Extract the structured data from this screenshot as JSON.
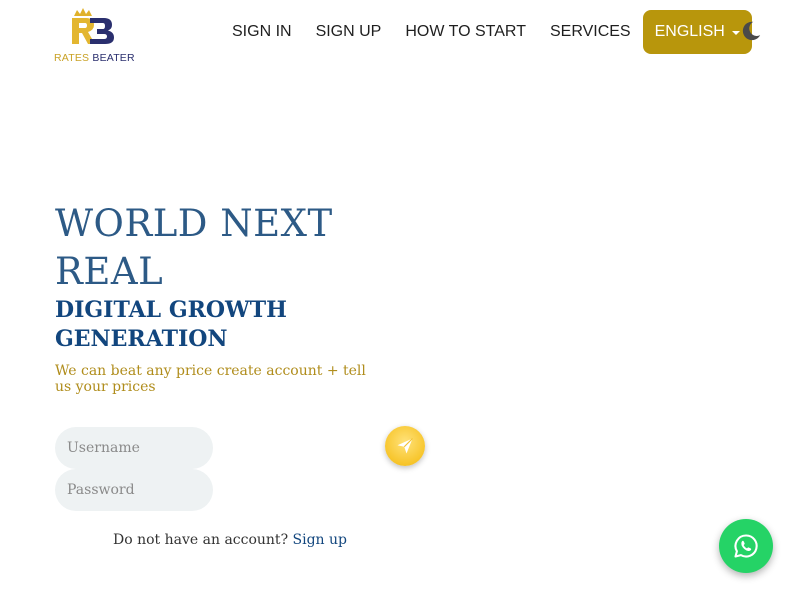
{
  "brand": {
    "logo_word_1": "RATES",
    "logo_word_2": "BEATER",
    "accent_gold": "#b8960c",
    "navy": "#12467e"
  },
  "nav": {
    "items": [
      {
        "label": "SIGN IN"
      },
      {
        "label": "SIGN UP"
      },
      {
        "label": "HOW TO START"
      },
      {
        "label": "SERVICES"
      }
    ],
    "language_label": "ENGLISH",
    "language_icon": "chevron-down-icon",
    "theme_icon": "moon-icon"
  },
  "hero": {
    "title_line_1": "WORLD NEXT",
    "title_line_2": "REAL",
    "subtitle_line_1": "DIGITAL GROWTH",
    "subtitle_line_2": "GENERATION",
    "description": "We can beat any price create account + tell us your prices"
  },
  "form": {
    "username_placeholder": "Username",
    "password_placeholder": "Password",
    "submit_icon": "paper-plane-icon",
    "signup_prompt": "Do not have an account?",
    "signup_link": "Sign up"
  },
  "chat": {
    "icon": "whatsapp-icon",
    "color": "#25d366"
  }
}
